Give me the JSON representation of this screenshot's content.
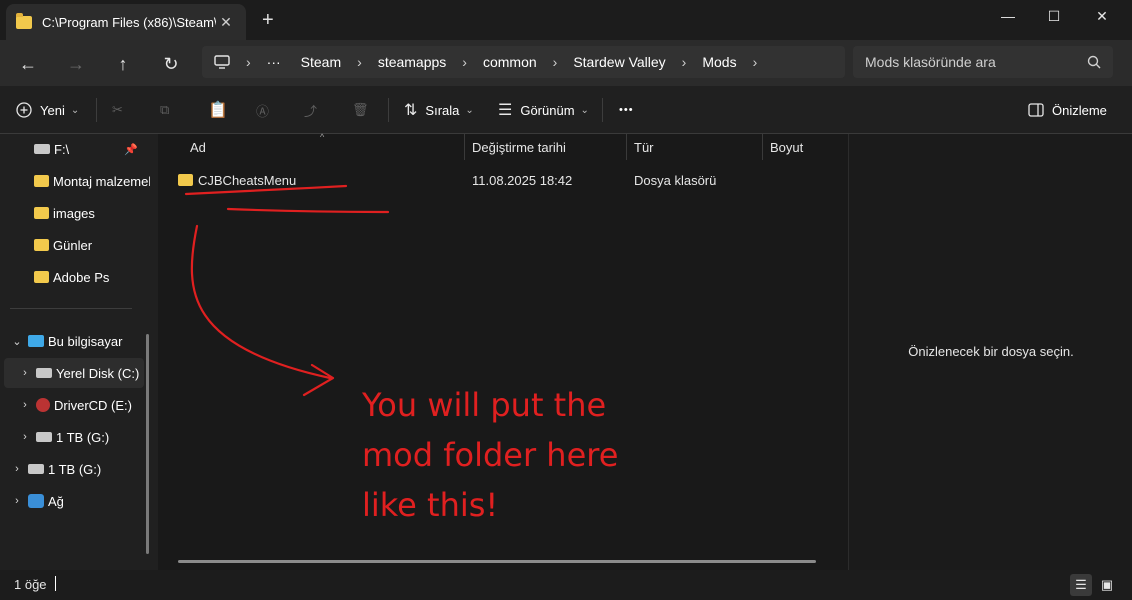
{
  "tab": {
    "title": "C:\\Program Files (x86)\\Steam\\",
    "close_label": "✕",
    "new_tab_label": "+"
  },
  "window": {
    "minimize": "—",
    "maximize": "☐",
    "close": "✕"
  },
  "nav": {
    "back": "←",
    "forward": "→",
    "up": "↑",
    "refresh": "↻"
  },
  "address": {
    "computer_icon": "computer-icon",
    "overflow": "···",
    "crumbs": [
      "Steam",
      "steamapps",
      "common",
      "Stardew Valley",
      "Mods"
    ]
  },
  "search": {
    "placeholder": "Mods klasöründe ara",
    "icon": "search-icon"
  },
  "toolbar": {
    "new_label": "Yeni",
    "sort_label": "Sırala",
    "view_label": "Görünüm",
    "more_label": "•••",
    "preview_label": "Önizleme"
  },
  "sidebar": {
    "quick": [
      {
        "label": "F:\\",
        "icon": "drive-icon",
        "pinned": true
      },
      {
        "label": "Montaj malzemeleri",
        "icon": "folder-icon"
      },
      {
        "label": "images",
        "icon": "folder-icon"
      },
      {
        "label": "Günler",
        "icon": "folder-icon"
      },
      {
        "label": "Adobe Ps",
        "icon": "folder-icon"
      }
    ],
    "this_pc": "Bu bilgisayar",
    "drives": [
      {
        "label": "Yerel Disk (C:)",
        "icon": "local-disk-icon"
      },
      {
        "label": "DriverCD (E:)",
        "icon": "cd-drive-icon"
      },
      {
        "label": "1 TB (G:)",
        "icon": "drive-icon"
      }
    ],
    "external": "1 TB (G:)",
    "network": "Ağ"
  },
  "columns": {
    "name": "Ad",
    "date": "Değiştirme tarihi",
    "type": "Tür",
    "size": "Boyut"
  },
  "files": [
    {
      "name": "CJBCheatsMenu",
      "date": "11.08.2025 18:42",
      "type": "Dosya klasörü",
      "size": ""
    }
  ],
  "preview": {
    "empty_text": "Önizlenecek bir dosya seçin."
  },
  "annotation": {
    "lines": [
      "You will put the",
      "mod folder here",
      "like this!"
    ],
    "color": "#e02020"
  },
  "status": {
    "count": "1 öğe"
  },
  "colors": {
    "folder": "#f2c94c",
    "background": "#202020",
    "accent": "#e02020"
  }
}
